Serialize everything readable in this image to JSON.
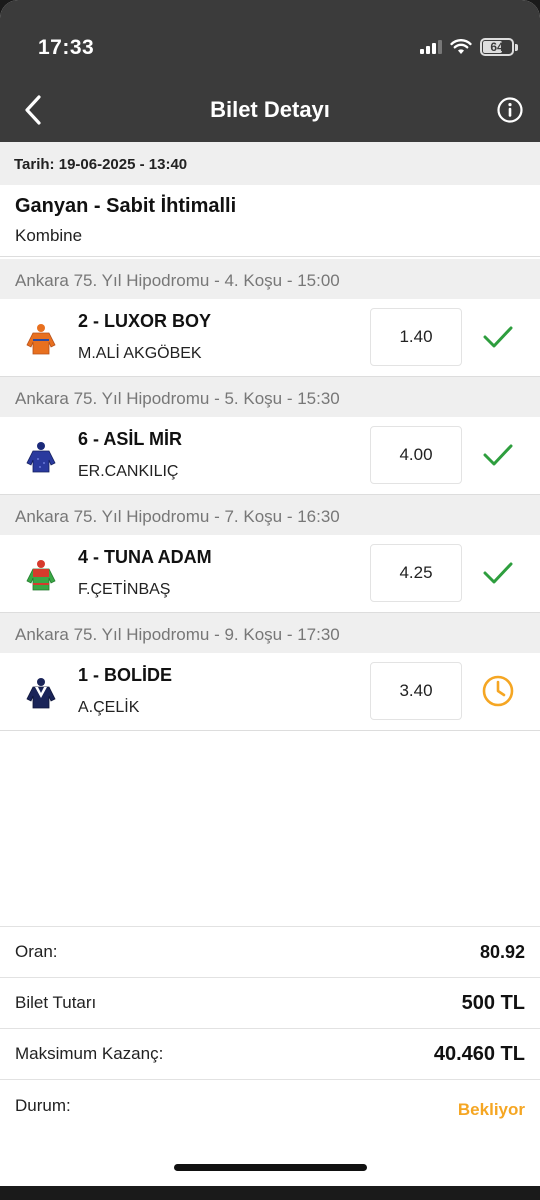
{
  "status_bar": {
    "time": "17:33",
    "battery": "64"
  },
  "header": {
    "title": "Bilet Detayı"
  },
  "ticket": {
    "date": "Tarih: 19-06-2025 - 13:40",
    "bet_type": "Ganyan - Sabit İhtimalli",
    "bet_subtype": "Kombine"
  },
  "races": [
    {
      "header": "Ankara 75. Yıl Hipodromu - 4. Koşu - 15:00",
      "horse": "2 - LUXOR BOY",
      "jockey": "M.ALİ AKGÖBEK",
      "odds": "1.40",
      "status": "won",
      "jersey_icon": "orange-jersey-icon"
    },
    {
      "header": "Ankara 75. Yıl Hipodromu - 5. Koşu - 15:30",
      "horse": "6 - ASİL MİR",
      "jockey": "ER.CANKILIÇ",
      "odds": "4.00",
      "status": "won",
      "jersey_icon": "blue-jersey-icon"
    },
    {
      "header": "Ankara 75. Yıl Hipodromu - 7. Koşu - 16:30",
      "horse": "4 - TUNA ADAM",
      "jockey": "F.ÇETİNBAŞ",
      "odds": "4.25",
      "status": "won",
      "jersey_icon": "green-red-jersey-icon"
    },
    {
      "header": "Ankara 75. Yıl Hipodromu - 9. Koşu - 17:30",
      "horse": "1 - BOLİDE",
      "jockey": "A.ÇELİK",
      "odds": "3.40",
      "status": "pending",
      "jersey_icon": "navy-white-jersey-icon"
    }
  ],
  "summary": {
    "odds_label": "Oran:",
    "odds_value": "80.92",
    "amount_label": "Bilet Tutarı",
    "amount_value": "500 TL",
    "max_win_label": "Maksimum Kazanç:",
    "max_win_value": "40.460 TL",
    "status_label": "Durum:",
    "status_value": "Bekliyor"
  },
  "colors": {
    "header_bg": "#3b3b3b",
    "won_check": "#2e9e3e",
    "pending": "#f5a623",
    "section_bg": "#efefef"
  }
}
